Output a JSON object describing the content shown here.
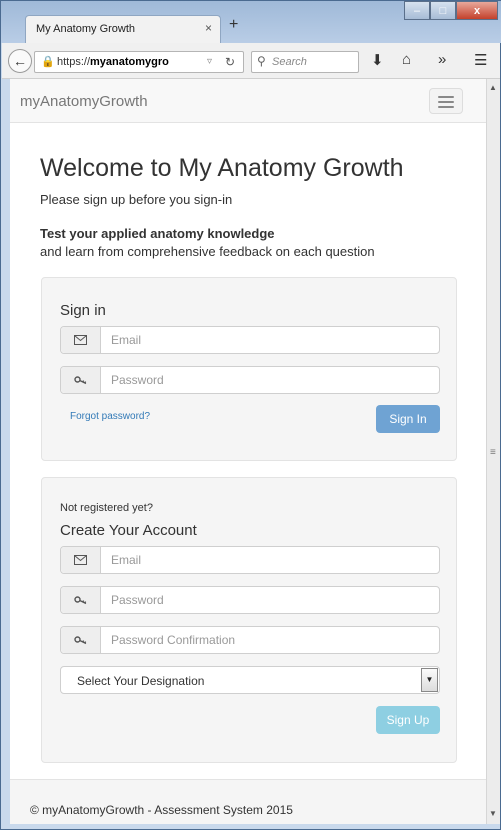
{
  "browser": {
    "tab_title": "My Anatomy Growth",
    "tab_close": "×",
    "new_tab": "+",
    "url_prefix": "https://",
    "url_host": "myanatomygro",
    "search_placeholder": "Search",
    "window_buttons": {
      "minimize": "–",
      "maximize": "□",
      "close": "x"
    }
  },
  "app": {
    "brand": "myAnatomyGrowth"
  },
  "intro": {
    "heading": "Welcome to My Anatomy Growth",
    "subtitle": "Please sign up before you sign-in",
    "tagline_bold": "Test your applied anatomy knowledge",
    "tagline": "and learn from comprehensive feedback on each question"
  },
  "signin": {
    "title": "Sign in",
    "email_placeholder": "Email",
    "password_placeholder": "Password",
    "forgot_label": "Forgot password?",
    "button_label": "Sign In",
    "button_color": "#6fa3d3"
  },
  "signup": {
    "question": "Not registered yet?",
    "title": "Create Your Account",
    "email_placeholder": "Email",
    "password_placeholder": "Password",
    "password_confirm_placeholder": "Password Confirmation",
    "designation_selected": "Select Your Designation",
    "button_label": "Sign Up",
    "button_color": "#8ecfe2"
  },
  "footer": {
    "text": "© myAnatomyGrowth - Assessment System 2015"
  }
}
